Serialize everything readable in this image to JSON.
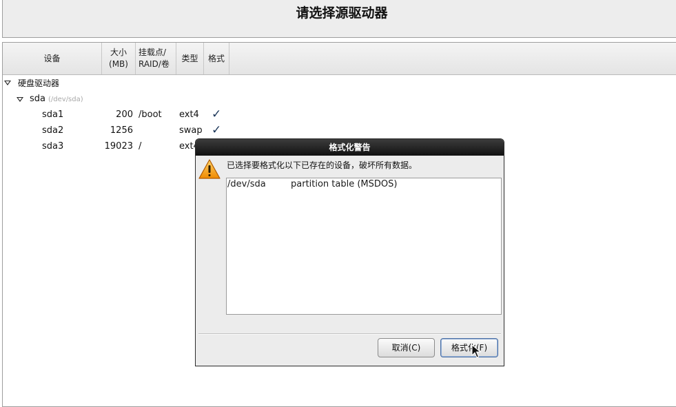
{
  "header": {
    "title": "请选择源驱动器"
  },
  "table": {
    "columns": [
      {
        "label": "设备"
      },
      {
        "label": "大小\n(MB)"
      },
      {
        "label": "挂载点/\nRAID/卷"
      },
      {
        "label": "类型"
      },
      {
        "label": "格式"
      }
    ],
    "group_label": "硬盘驱动器",
    "disk": {
      "name": "sda",
      "path": "(/dev/sda)"
    },
    "rows": [
      {
        "device": "sda1",
        "size": "200",
        "mount": "/boot",
        "type": "ext4",
        "format": "✓"
      },
      {
        "device": "sda2",
        "size": "1256",
        "mount": "",
        "type": "swap",
        "format": "✓"
      },
      {
        "device": "sda3",
        "size": "19023",
        "mount": "/",
        "type": "ext4",
        "format": ""
      }
    ]
  },
  "dialog": {
    "title": "格式化警告",
    "message": "已选择要格式化以下已存在的设备，破坏所有数据。",
    "icon": "warning-icon",
    "devices": [
      {
        "device": "/dev/sda",
        "description": "partition table (MSDOS)"
      }
    ],
    "buttons": {
      "cancel": "取消(C)",
      "format": "格式化(F)"
    }
  },
  "colors": {
    "titlebar": "#111111",
    "warning": "#f39c12",
    "focus": "#4a6fa5"
  }
}
